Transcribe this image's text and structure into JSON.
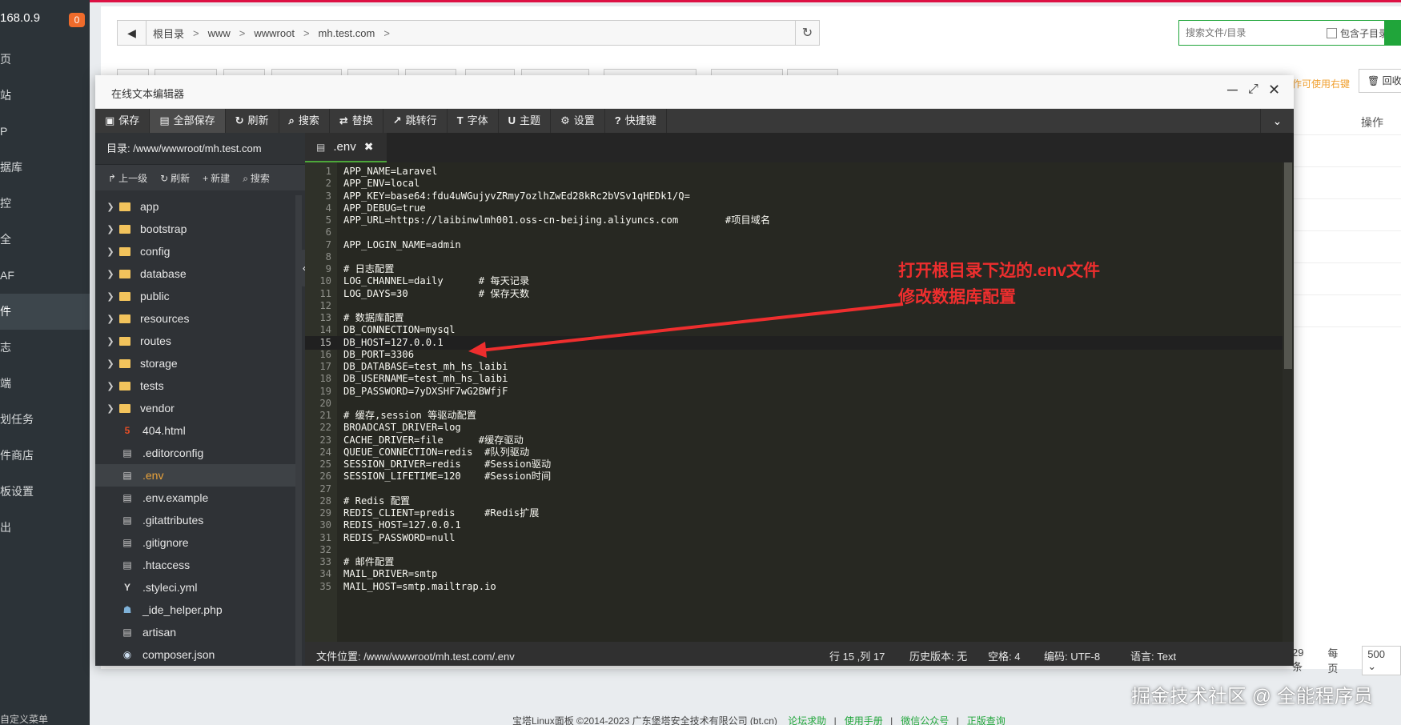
{
  "sidebar": {
    "ip_fragment": "168.0.9",
    "badge": "0",
    "items": [
      {
        "label": "页",
        "active": false
      },
      {
        "label": "站",
        "active": false
      },
      {
        "label": "P",
        "active": false
      },
      {
        "label": "据库",
        "active": false
      },
      {
        "label": "控",
        "active": false
      },
      {
        "label": "全",
        "active": false
      },
      {
        "label": "AF",
        "active": false
      },
      {
        "label": "件",
        "active": true
      },
      {
        "label": "志",
        "active": false
      },
      {
        "label": "端",
        "active": false
      },
      {
        "label": "划任务",
        "active": false
      },
      {
        "label": "件商店",
        "active": false
      },
      {
        "label": "板设置",
        "active": false
      },
      {
        "label": "出",
        "active": false
      }
    ],
    "custom_menu": "自定义菜单"
  },
  "pathbar": {
    "crumbs": [
      "根目录",
      "www",
      "wwwroot",
      "mh.test.com"
    ],
    "separator": ">"
  },
  "search": {
    "placeholder": "搜索文件/目录",
    "include_subdir_label": "包含子目录"
  },
  "background": {
    "right_click_hint": "作可使用右键",
    "recycle_label": "回收",
    "operations_header": "操作",
    "pager_count": "29条",
    "per_page_label": "每页",
    "per_page_value": "500"
  },
  "footer": {
    "copyright": "宝塔Linux面板 ©2014-2023 广东堡塔安全技术有限公司 (bt.cn)",
    "links": [
      "论坛求助",
      "使用手册",
      "微信公众号",
      "正版查询"
    ]
  },
  "watermark": "掘金技术社区 @ 全能程序员",
  "editor": {
    "title": "在线文本编辑器",
    "toolbar": [
      {
        "icon": "save-icon",
        "glyph": "▣",
        "label": "保存"
      },
      {
        "icon": "save-all-icon",
        "glyph": "▤",
        "label": "全部保存"
      },
      {
        "icon": "refresh-icon",
        "glyph": "↻",
        "label": "刷新"
      },
      {
        "icon": "search-icon",
        "glyph": "⌕",
        "label": "搜索"
      },
      {
        "icon": "replace-icon",
        "glyph": "⇄",
        "label": "替换"
      },
      {
        "icon": "goto-line-icon",
        "glyph": "↗",
        "label": "跳转行"
      },
      {
        "icon": "font-icon",
        "glyph": "T",
        "label": "字体"
      },
      {
        "icon": "theme-icon",
        "glyph": "U",
        "label": "主题"
      },
      {
        "icon": "settings-icon",
        "glyph": "⚙",
        "label": "设置"
      },
      {
        "icon": "shortcut-icon",
        "glyph": "?",
        "label": "快捷键"
      }
    ],
    "directory_label": "目录: /www/wwwroot/mh.test.com",
    "dir_tools": [
      {
        "icon": "up-level-icon",
        "glyph": "↱",
        "label": "上一级"
      },
      {
        "icon": "refresh-icon",
        "glyph": "↻",
        "label": "刷新"
      },
      {
        "icon": "new-icon",
        "glyph": "+",
        "label": "新建"
      },
      {
        "icon": "search-icon",
        "glyph": "⌕",
        "label": "搜索"
      }
    ],
    "files": [
      {
        "name": "app",
        "type": "folder"
      },
      {
        "name": "bootstrap",
        "type": "folder"
      },
      {
        "name": "config",
        "type": "folder"
      },
      {
        "name": "database",
        "type": "folder"
      },
      {
        "name": "public",
        "type": "folder"
      },
      {
        "name": "resources",
        "type": "folder"
      },
      {
        "name": "routes",
        "type": "folder"
      },
      {
        "name": "storage",
        "type": "folder"
      },
      {
        "name": "tests",
        "type": "folder"
      },
      {
        "name": "vendor",
        "type": "folder"
      },
      {
        "name": "404.html",
        "type": "html",
        "glyph": "5"
      },
      {
        "name": ".editorconfig",
        "type": "file",
        "glyph": "▤"
      },
      {
        "name": ".env",
        "type": "file",
        "glyph": "▤",
        "selected": true
      },
      {
        "name": ".env.example",
        "type": "file",
        "glyph": "▤"
      },
      {
        "name": ".gitattributes",
        "type": "file",
        "glyph": "▤"
      },
      {
        "name": ".gitignore",
        "type": "file",
        "glyph": "▤"
      },
      {
        "name": ".htaccess",
        "type": "file",
        "glyph": "▤"
      },
      {
        "name": ".styleci.yml",
        "type": "yml",
        "glyph": "Y"
      },
      {
        "name": "_ide_helper.php",
        "type": "php",
        "glyph": "☗"
      },
      {
        "name": "artisan",
        "type": "file",
        "glyph": "▤"
      },
      {
        "name": "composer.json",
        "type": "json",
        "glyph": "◉"
      }
    ],
    "tab": {
      "name": ".env",
      "close": "✖"
    },
    "current_line": 15,
    "lines": [
      "APP_NAME=Laravel",
      "APP_ENV=local",
      "APP_KEY=base64:fdu4uWGujyvZRmy7ozlhZwEd28kRc2bVSv1qHEDk1/Q=",
      "APP_DEBUG=true",
      "APP_URL=https://laibinwlmh001.oss-cn-beijing.aliyuncs.com        #项目域名",
      "",
      "APP_LOGIN_NAME=admin",
      "",
      "# 日志配置",
      "LOG_CHANNEL=daily      # 每天记录",
      "LOG_DAYS=30            # 保存天数",
      "",
      "# 数据库配置",
      "DB_CONNECTION=mysql",
      "DB_HOST=127.0.0.1",
      "DB_PORT=3306",
      "DB_DATABASE=test_mh_hs_laibi",
      "DB_USERNAME=test_mh_hs_laibi",
      "DB_PASSWORD=7yDXSHF7wG2BWfjF",
      "",
      "# 缓存,session 等驱动配置",
      "BROADCAST_DRIVER=log",
      "CACHE_DRIVER=file      #缓存驱动",
      "QUEUE_CONNECTION=redis  #队列驱动",
      "SESSION_DRIVER=redis    #Session驱动",
      "SESSION_LIFETIME=120    #Session时间",
      "",
      "# Redis 配置",
      "REDIS_CLIENT=predis     #Redis扩展",
      "REDIS_HOST=127.0.0.1",
      "REDIS_PASSWORD=null",
      "",
      "# 邮件配置",
      "MAIL_DRIVER=smtp",
      "MAIL_HOST=smtp.mailtrap.io"
    ],
    "status": {
      "file_location": "文件位置: /www/wwwroot/mh.test.com/.env",
      "cursor": "行 15 ,列 17",
      "history": "历史版本: 无",
      "indent": "空格: 4",
      "encoding": "编码: UTF-8",
      "language": "语言: Text"
    }
  },
  "annotation": {
    "line1": "打开根目录下边的.env文件",
    "line2": "修改数据库配置",
    "color": "#ee2e2e"
  }
}
